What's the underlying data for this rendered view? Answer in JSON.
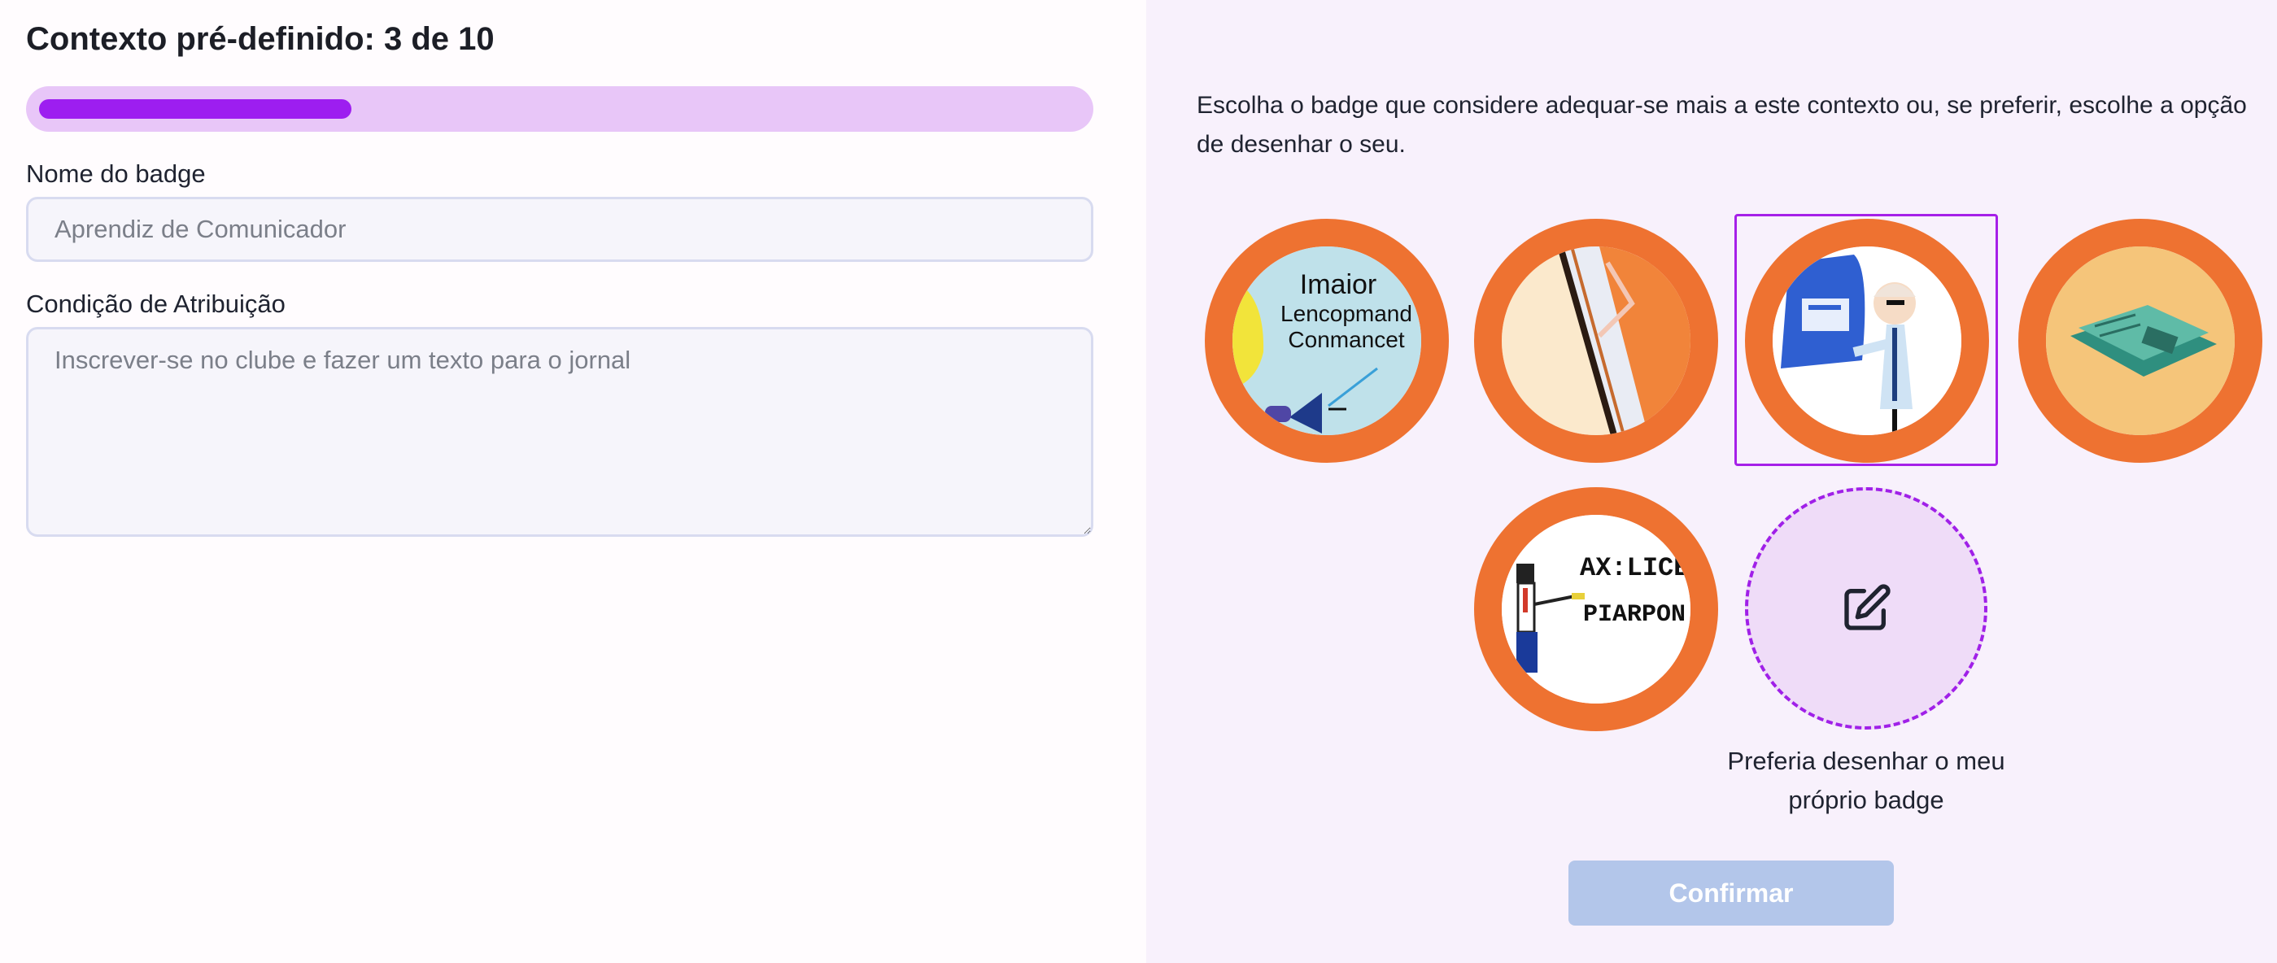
{
  "form": {
    "title": "Contexto pré-definido: 3 de 10",
    "progress": {
      "current": 3,
      "total": 10,
      "fraction": 0.3
    },
    "name_label": "Nome do badge",
    "name_placeholder": "Aprendiz de Comunicador",
    "condition_label": "Condição de Atribuição",
    "condition_placeholder": "Inscrever-se no clube e fazer um texto para o jornal"
  },
  "chooser": {
    "instructions": "Escolha o badge que considere adequar-se mais a este contexto ou, se preferir, escolhe a opção de desenhar o seu.",
    "badges": [
      {
        "icon": "megaphone-text-badge",
        "selected": false,
        "image_text": [
          "Imaior",
          "Lencopmand",
          "Conmancet"
        ]
      },
      {
        "icon": "pencil-paper-badge",
        "selected": false
      },
      {
        "icon": "teacher-presentation-badge",
        "selected": true
      },
      {
        "icon": "newspaper-badge",
        "selected": false
      },
      {
        "icon": "pixel-teacher-badge",
        "selected": false,
        "image_text": [
          "AX:LICEN",
          "PIARPON"
        ]
      }
    ],
    "draw_own_icon": "edit-icon",
    "draw_own_label": "Preferia desenhar o meu próprio badge",
    "confirm_label": "Confirmar",
    "colors": {
      "accent": "#9d1ef0",
      "badge_ring": "#ee7231",
      "confirm_disabled": "#b3c6ea"
    }
  }
}
